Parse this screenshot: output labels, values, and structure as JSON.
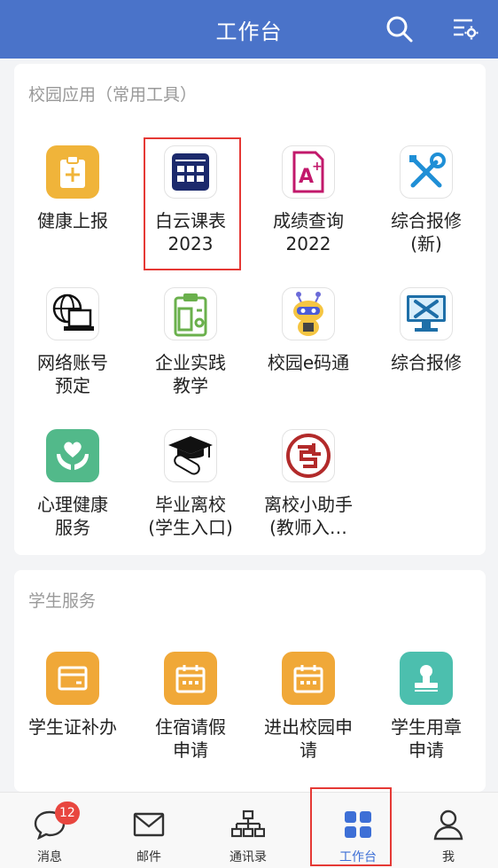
{
  "header": {
    "title": "工作台"
  },
  "campus": {
    "title": "校园应用（常用工具）",
    "apps": [
      {
        "label": "健康上报"
      },
      {
        "label": "白云课表\n2023"
      },
      {
        "label": "成绩查询\n2022"
      },
      {
        "label": "综合报修\n(新)"
      },
      {
        "label": "网络账号\n预定"
      },
      {
        "label": "企业实践\n教学"
      },
      {
        "label": "校园e码通"
      },
      {
        "label": "综合报修"
      },
      {
        "label": "心理健康\n服务"
      },
      {
        "label": "毕业离校\n(学生入口)"
      },
      {
        "label": "离校小助手\n(教师入…"
      }
    ]
  },
  "student": {
    "title": "学生服务",
    "apps": [
      {
        "label": "学生证补办"
      },
      {
        "label": "住宿请假\n申请"
      },
      {
        "label": "进出校园申\n请"
      },
      {
        "label": "学生用章\n申请"
      }
    ]
  },
  "tabbar": {
    "tabs": [
      {
        "label": "消息",
        "badge": "12"
      },
      {
        "label": "邮件"
      },
      {
        "label": "通讯录"
      },
      {
        "label": "工作台"
      },
      {
        "label": "我"
      }
    ]
  },
  "colors": {
    "header": "#4a73c9",
    "accent": "#3d6fd6",
    "highlight": "#e53935",
    "orange": "#f0a838",
    "teal": "#4cbfae"
  }
}
